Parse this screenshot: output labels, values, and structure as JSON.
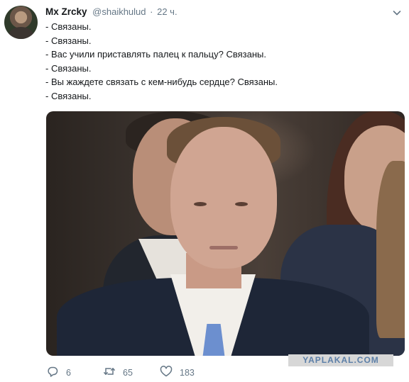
{
  "tweet": {
    "display_name": "Mx Zrcky",
    "handle": "@shaikhulud",
    "separator": "·",
    "time": "22 ч.",
    "lines": [
      "- Связаны.",
      "- Связаны.",
      "- Вас учили приставлять палец к пальцу? Связаны.",
      "- Связаны.",
      "- Вы жаждете связать с кем-нибудь сердце? Связаны.",
      "- Связаны."
    ],
    "replies": "6",
    "retweets": "65",
    "likes": "183"
  },
  "watermark": "YAPLAKAL.COM",
  "icons": {
    "reply": "reply-icon",
    "retweet": "retweet-icon",
    "like": "heart-icon",
    "menu": "chevron-down-icon"
  },
  "colors": {
    "text": "#14171a",
    "secondary": "#657786",
    "watermark_text": "#5c7fa8"
  }
}
